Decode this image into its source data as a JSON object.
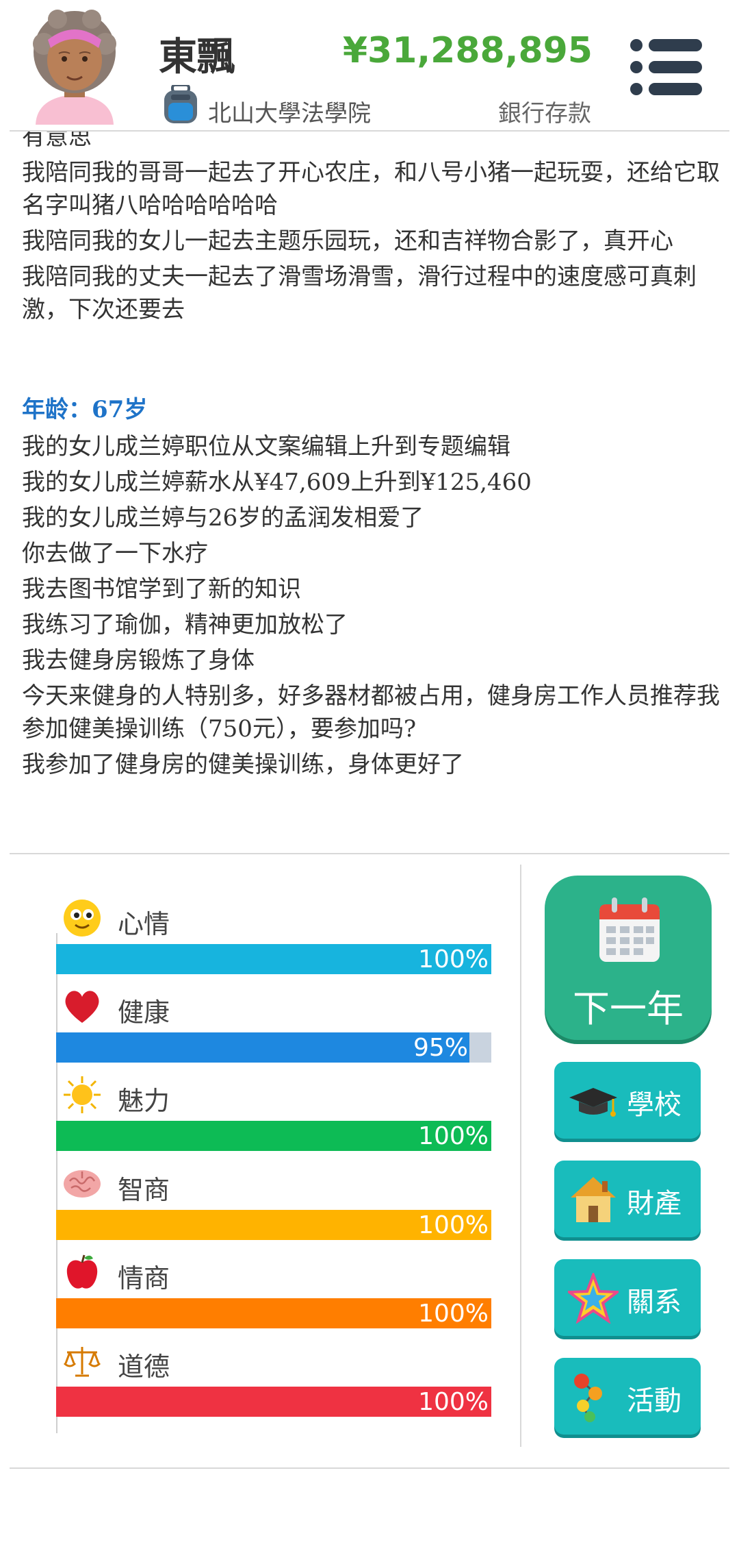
{
  "header": {
    "name": "東飄",
    "school": "北山大學法學院",
    "money": "¥31,288,895",
    "money_label": "銀行存款"
  },
  "log": {
    "lines_before": [
      "有意思",
      "我陪同我的哥哥一起去了开心农庄，和八号小猪一起玩耍，还给它取名字叫猪八哈哈哈哈哈哈",
      "我陪同我的女儿一起去主题乐园玩，还和吉祥物合影了，真开心",
      "我陪同我的丈夫一起去了滑雪场滑雪，滑行过程中的速度感可真刺激，下次还要去"
    ],
    "age_heading": "年龄：67岁",
    "lines_after": [
      "我的女儿成兰婷职位从文案编辑上升到专题编辑",
      "我的女儿成兰婷薪水从¥47,609上升到¥125,460",
      "我的女儿成兰婷与26岁的孟润发相爱了",
      "你去做了一下水疗",
      "我去图书馆学到了新的知识",
      "我练习了瑜伽，精神更加放松了",
      "我去健身房锻炼了身体",
      "今天来健身的人特别多，好多器材都被占用，健身房工作人员推荐我参加健美操训练（750元），要参加吗?",
      "我参加了健身房的健美操训练，身体更好了"
    ]
  },
  "stats": [
    {
      "label": "心情",
      "icon": "smiley-icon",
      "percent": 100,
      "percent_text": "100%",
      "color": "#17b4de"
    },
    {
      "label": "健康",
      "icon": "heart-icon",
      "percent": 95,
      "percent_text": "95%",
      "color": "#1e88e0"
    },
    {
      "label": "魅力",
      "icon": "sun-icon",
      "percent": 100,
      "percent_text": "100%",
      "color": "#0dbb55"
    },
    {
      "label": "智商",
      "icon": "brain-icon",
      "percent": 100,
      "percent_text": "100%",
      "color": "#ffb300"
    },
    {
      "label": "情商",
      "icon": "apple-icon",
      "percent": 100,
      "percent_text": "100%",
      "color": "#ff7e00"
    },
    {
      "label": "道德",
      "icon": "scales-icon",
      "percent": 100,
      "percent_text": "100%",
      "color": "#ef3242"
    }
  ],
  "actions": {
    "next_year": "下一年",
    "school": "學校",
    "property": "財產",
    "relations": "關系",
    "activities": "活動"
  },
  "colors": {
    "money": "#4aa83a",
    "age_heading": "#1e73c8",
    "next_button": "#2cb28a",
    "side_button": "#19bcbc"
  }
}
